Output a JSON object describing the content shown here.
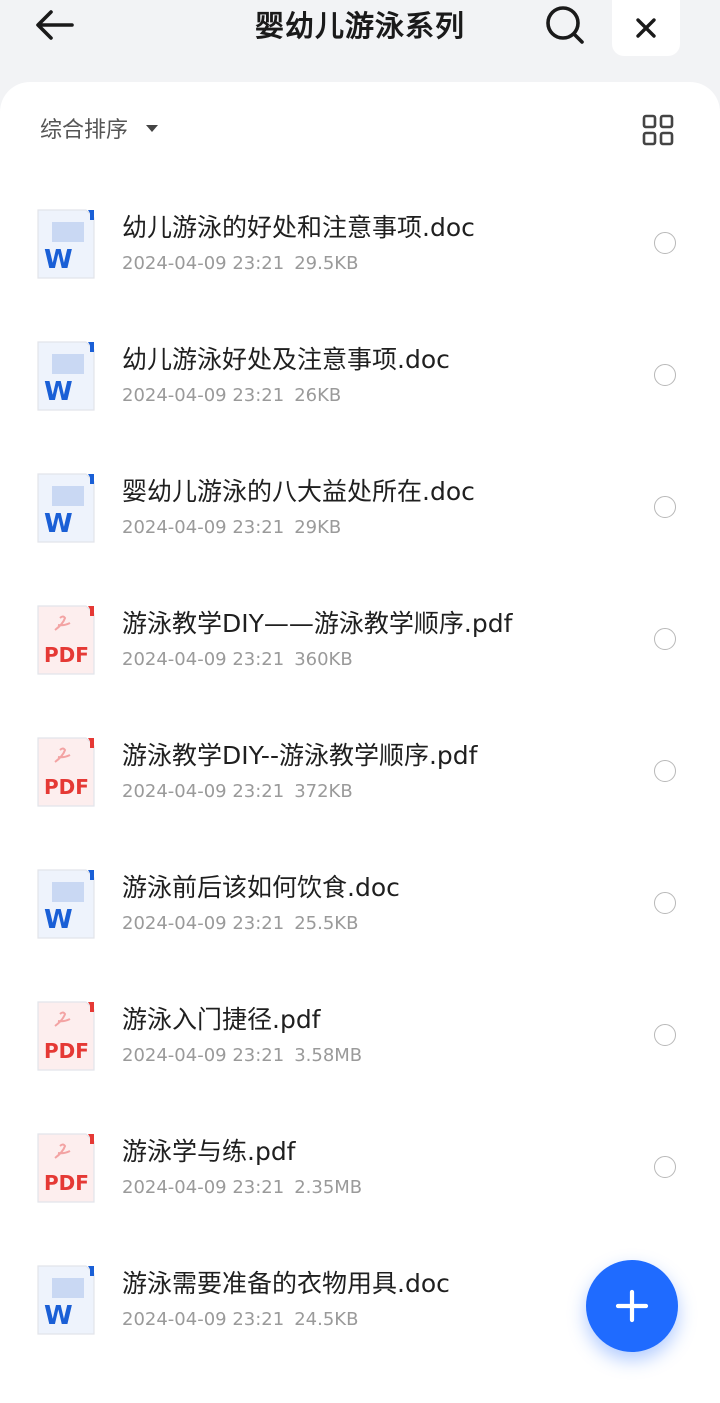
{
  "header": {
    "title": "婴幼儿游泳系列",
    "back_icon": "arrow-left-icon",
    "search_icon": "search-icon",
    "close_icon": "close-icon"
  },
  "toolbar": {
    "sort_label": "综合排序",
    "view_icon": "grid-view-icon"
  },
  "colors": {
    "word": "#1a5fd6",
    "pdf": "#e53935",
    "accent": "#1f6bff"
  },
  "files": [
    {
      "name": "幼儿游泳的好处和注意事项.doc",
      "date": "2024-04-09 23:21",
      "size": "29.5KB",
      "type": "doc",
      "badge": "W"
    },
    {
      "name": "幼儿游泳好处及注意事项.doc",
      "date": "2024-04-09 23:21",
      "size": "26KB",
      "type": "doc",
      "badge": "W"
    },
    {
      "name": "婴幼儿游泳的八大益处所在.doc",
      "date": "2024-04-09 23:21",
      "size": "29KB",
      "type": "doc",
      "badge": "W"
    },
    {
      "name": "游泳教学DIY——游泳教学顺序.pdf",
      "date": "2024-04-09 23:21",
      "size": "360KB",
      "type": "pdf",
      "badge": "PDF"
    },
    {
      "name": "游泳教学DIY--游泳教学顺序.pdf",
      "date": "2024-04-09 23:21",
      "size": "372KB",
      "type": "pdf",
      "badge": "PDF"
    },
    {
      "name": "游泳前后该如何饮食.doc",
      "date": "2024-04-09 23:21",
      "size": "25.5KB",
      "type": "doc",
      "badge": "W"
    },
    {
      "name": "游泳入门捷径.pdf",
      "date": "2024-04-09 23:21",
      "size": "3.58MB",
      "type": "pdf",
      "badge": "PDF"
    },
    {
      "name": "游泳学与练.pdf",
      "date": "2024-04-09 23:21",
      "size": "2.35MB",
      "type": "pdf",
      "badge": "PDF"
    },
    {
      "name": "游泳需要准备的衣物用具.doc",
      "date": "2024-04-09 23:21",
      "size": "24.5KB",
      "type": "doc",
      "badge": "W"
    }
  ],
  "fab": {
    "icon": "plus-icon"
  }
}
